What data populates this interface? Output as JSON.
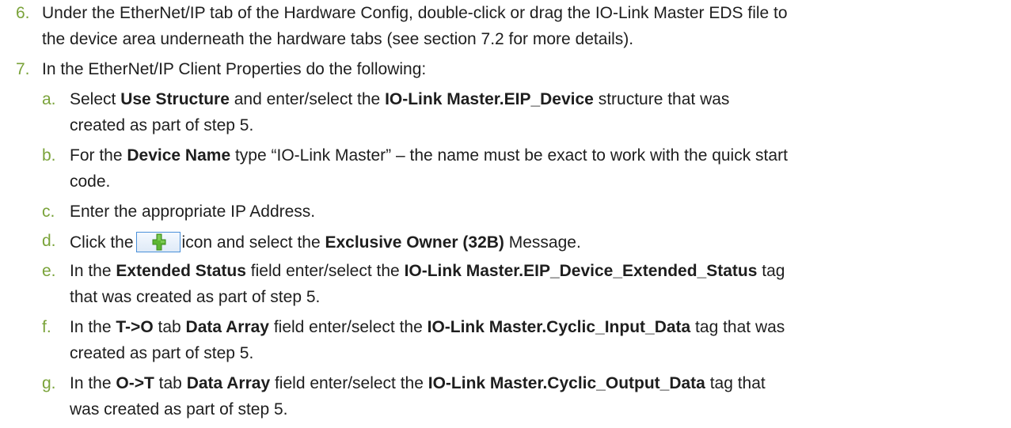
{
  "items": [
    {
      "marker": "6.",
      "lines": [
        "Under the EtherNet/IP tab of the Hardware Config, double-click or drag the IO-Link Master EDS file to",
        "the device area underneath the hardware tabs (see section 7.2 for more details)."
      ]
    },
    {
      "marker": "7.",
      "lines": [
        "In the EtherNet/IP Client Properties do the following:"
      ]
    }
  ],
  "subitems": {
    "a": {
      "marker": "a.",
      "l1_pre": "Select ",
      "l1_b1": "Use Structure",
      "l1_mid": " and enter/select the ",
      "l1_b2": "IO-Link Master.EIP_Device",
      "l1_post": " structure that was",
      "l2": "created as part of step 5."
    },
    "b": {
      "marker": "b.",
      "l1_pre": "For the ",
      "l1_b1": "Device Name",
      "l1_post": " type “IO-Link Master” – the name must be exact to work with the quick start",
      "l2": "code."
    },
    "c": {
      "marker": "c.",
      "l1": "Enter the appropriate IP Address."
    },
    "d": {
      "marker": "d.",
      "pre": "Click the",
      "icon": "add-plus-icon",
      "mid": "icon and select the ",
      "b1": "Exclusive Owner (32B)",
      "post": " Message."
    },
    "e": {
      "marker": "e.",
      "l1_pre": "In the ",
      "l1_b1": "Extended Status",
      "l1_mid": " field enter/select the ",
      "l1_b2": "IO-Link Master.EIP_Device_Extended_Status",
      "l1_post": " tag",
      "l2": "that was created as part of step 5."
    },
    "f": {
      "marker": "f.",
      "l1_pre": "In the ",
      "l1_b1": "T->O",
      "l1_mid1": " tab ",
      "l1_b2": "Data Array",
      "l1_mid2": " field enter/select the ",
      "l1_b3": "IO-Link Master.Cyclic_Input_Data",
      "l1_post": " tag that was",
      "l2": "created as part of step 5."
    },
    "g": {
      "marker": "g.",
      "l1_pre": "In the ",
      "l1_b1": "O->T",
      "l1_mid1": " tab ",
      "l1_b2": "Data Array",
      "l1_mid2": " field enter/select the ",
      "l1_b3": "IO-Link Master.Cyclic_Output_Data",
      "l1_post": " tag that",
      "l2": "was created as part of step 5."
    }
  },
  "colors": {
    "marker": "#7aa33a",
    "text": "#1e1e1e",
    "icon_border": "#4a90d9",
    "icon_plus": "#5cb531"
  }
}
